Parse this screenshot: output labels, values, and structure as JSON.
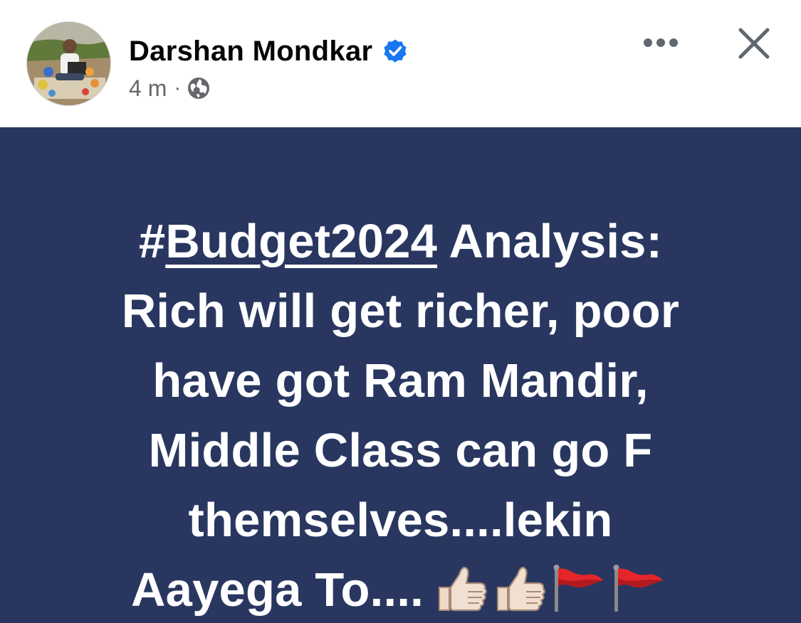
{
  "author": {
    "name": "Darshan Mondkar",
    "verified": true,
    "verified_color": "#1877f2"
  },
  "meta": {
    "time": "4 m",
    "separator": "·",
    "audience_icon": "globe-icon"
  },
  "header_actions": {
    "more_icon": "more-options-icon",
    "close_icon": "close-icon"
  },
  "post": {
    "background_color": "#293760",
    "text_color": "#ffffff",
    "hash": "#",
    "hashtag": "Budget2024",
    "line1_rest": " Analysis:",
    "line2": "Rich will get richer, poor",
    "line3": "have got Ram Mandir,",
    "line4": "Middle Class can go F",
    "line5": "themselves....lekin",
    "line6": "Aayega To....",
    "emojis": [
      "thumbs-up-icon",
      "thumbs-up-icon",
      "red-flag-icon",
      "red-flag-icon"
    ]
  }
}
